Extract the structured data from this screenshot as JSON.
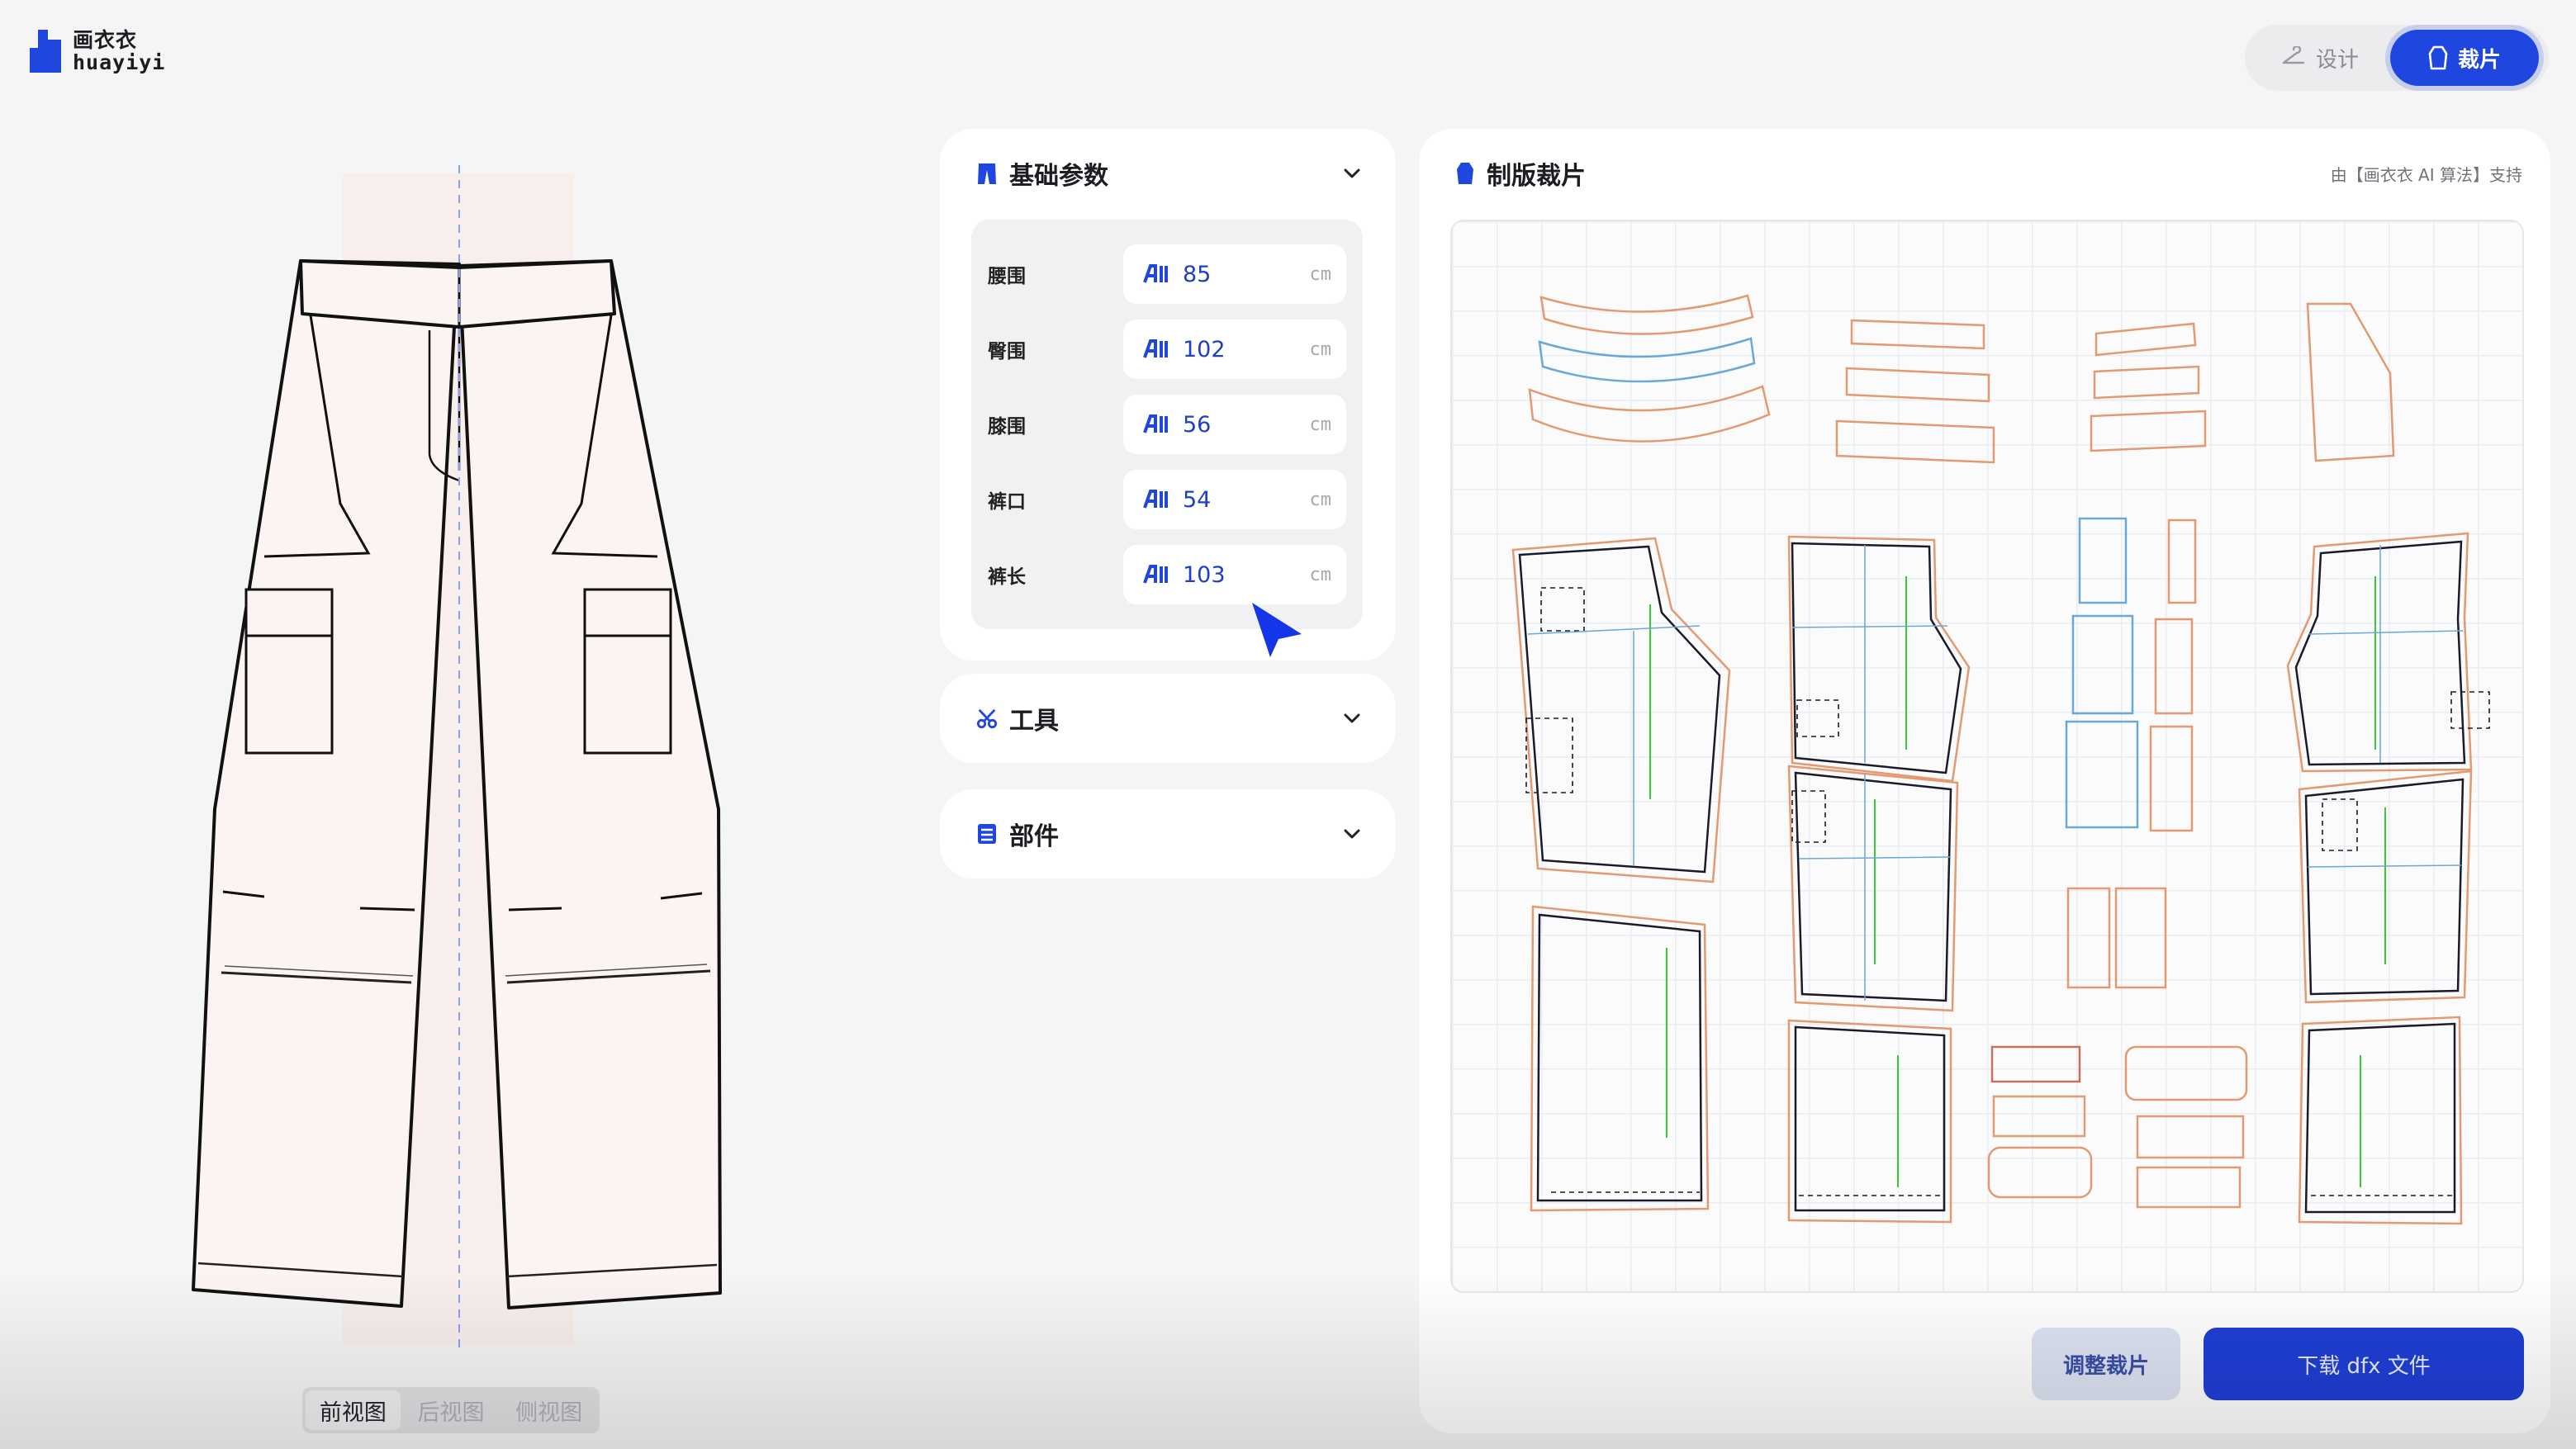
{
  "app": {
    "logo_cn": "画衣衣",
    "logo_en": "huayiyi",
    "brand_color": "#1f47e0"
  },
  "mode_toggle": {
    "design_label": "设计",
    "design_icon": "hanger-icon",
    "cut_label": "裁片",
    "cut_icon": "pattern-icon",
    "active": "cut"
  },
  "views": {
    "tabs": [
      "前视图",
      "后视图",
      "侧视图"
    ],
    "active": "前视图"
  },
  "params_panel": {
    "title": "基础参数",
    "icon": "trousers-icon",
    "rows": [
      {
        "label": "腰围",
        "value": "85",
        "unit": "cm"
      },
      {
        "label": "臀围",
        "value": "102",
        "unit": "cm"
      },
      {
        "label": "膝围",
        "value": "56",
        "unit": "cm"
      },
      {
        "label": "裤口",
        "value": "54",
        "unit": "cm"
      },
      {
        "label": "裤长",
        "value": "103",
        "unit": "cm"
      }
    ]
  },
  "tools_panel": {
    "title": "工具",
    "icon": "scissors-icon"
  },
  "parts_panel": {
    "title": "部件",
    "icon": "parts-icon"
  },
  "pattern_panel": {
    "title": "制版裁片",
    "icon": "pattern-icon",
    "credit": "由【画衣衣 AI 算法】支持"
  },
  "actions": {
    "adjust_label": "调整裁片",
    "download_label": "下载 dfx 文件"
  }
}
